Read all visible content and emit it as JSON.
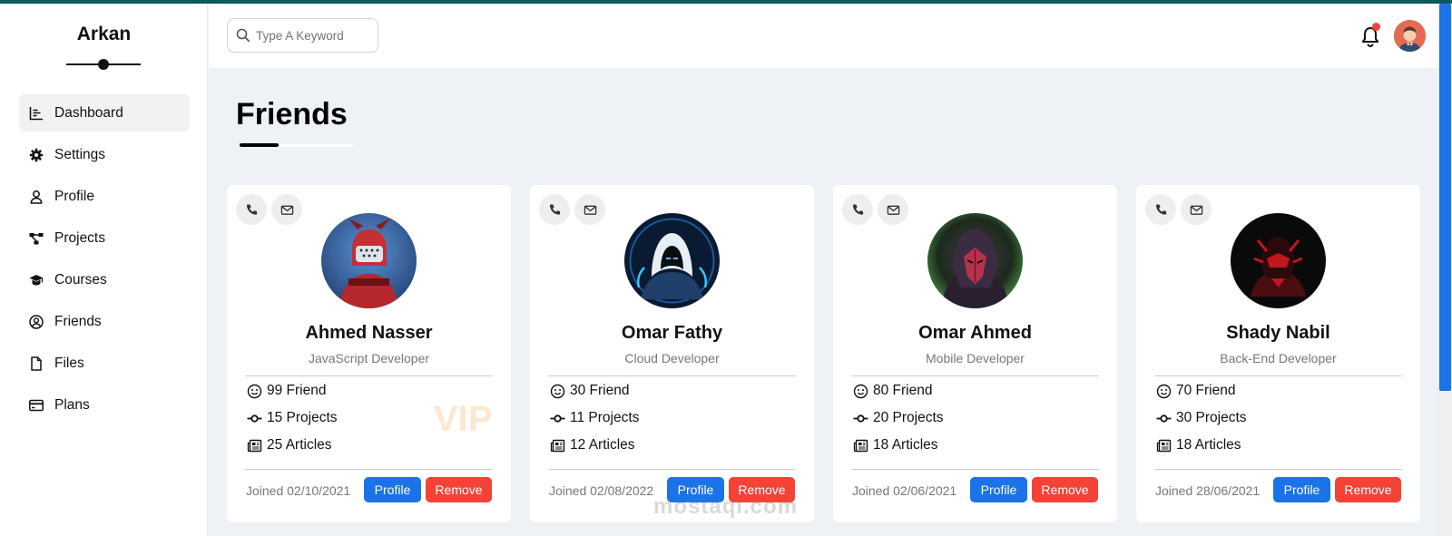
{
  "app": {
    "brand": "Arkan"
  },
  "sidebar": {
    "items": [
      {
        "label": "Dashboard",
        "icon": "chart-icon",
        "active": true
      },
      {
        "label": "Settings",
        "icon": "gear-icon",
        "active": false
      },
      {
        "label": "Profile",
        "icon": "user-icon",
        "active": false
      },
      {
        "label": "Projects",
        "icon": "diagram-icon",
        "active": false
      },
      {
        "label": "Courses",
        "icon": "graduation-cap-icon",
        "active": false
      },
      {
        "label": "Friends",
        "icon": "user-circle-icon",
        "active": false
      },
      {
        "label": "Files",
        "icon": "file-icon",
        "active": false
      },
      {
        "label": "Plans",
        "icon": "credit-card-icon",
        "active": false
      }
    ]
  },
  "header": {
    "search_placeholder": "Type A Keyword",
    "notification_icon": "bell-icon",
    "notification_dot_color": "#f44336"
  },
  "page": {
    "title": "Friends"
  },
  "friends": [
    {
      "name": "Ahmed Nasser",
      "role": "JavaScript Developer",
      "friends": "99 Friend",
      "projects": "15 Projects",
      "articles": "25 Articles",
      "joined": "Joined 02/10/2021",
      "profile_label": "Profile",
      "remove_label": "Remove"
    },
    {
      "name": "Omar Fathy",
      "role": "Cloud Developer",
      "friends": "30 Friend",
      "projects": "11 Projects",
      "articles": "12 Articles",
      "joined": "Joined 02/08/2022",
      "profile_label": "Profile",
      "remove_label": "Remove"
    },
    {
      "name": "Omar Ahmed",
      "role": "Mobile Developer",
      "friends": "80 Friend",
      "projects": "20 Projects",
      "articles": "18 Articles",
      "joined": "Joined 02/06/2021",
      "profile_label": "Profile",
      "remove_label": "Remove"
    },
    {
      "name": "Shady Nabil",
      "role": "Back-End Developer",
      "friends": "70 Friend",
      "projects": "30 Projects",
      "articles": "18 Articles",
      "joined": "Joined 28/06/2021",
      "profile_label": "Profile",
      "remove_label": "Remove"
    }
  ],
  "badges": {
    "vip": "VIP"
  },
  "watermark": "mostaql.com",
  "colors": {
    "primary": "#1a73e8",
    "danger": "#f44336",
    "accent_bar": "#0a5c5c"
  }
}
